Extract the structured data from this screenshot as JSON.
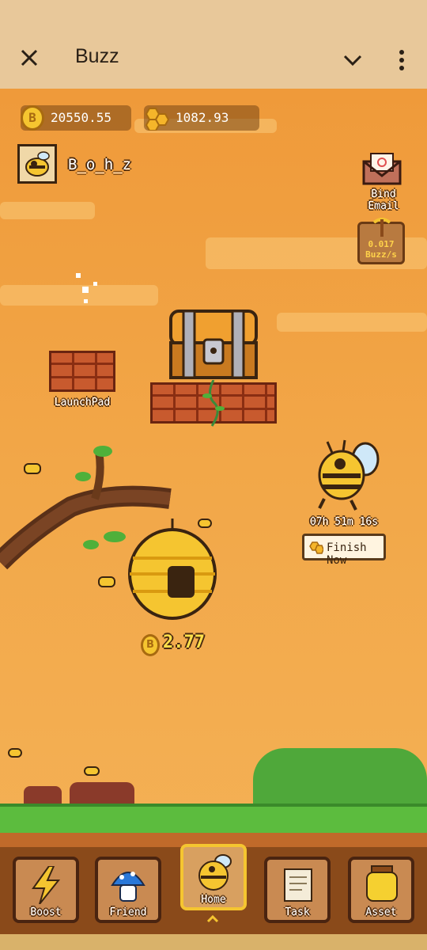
{
  "app_bar": {
    "title": "Buzz",
    "close_icon": "close-icon",
    "menu_icons": [
      "chevron-down-icon",
      "more-vert-icon"
    ]
  },
  "currencies": [
    {
      "icon": "coin-icon",
      "value": "20550.55"
    },
    {
      "icon": "honeycomb-icon",
      "value": "1082.93"
    }
  ],
  "user": {
    "name": "B_o_h_z",
    "avatar_icon": "bee-avatar-icon"
  },
  "side_actions": {
    "bind_email": "Bind Email",
    "mining_rate": "0.017",
    "mining_unit": "Buzz/s"
  },
  "launchpad": {
    "label": "LaunchPad"
  },
  "bee_timer": {
    "time": "07h 51m 16s",
    "button": "Finish Now"
  },
  "hive": {
    "coin_value": "2.77"
  },
  "nav": [
    {
      "label": "Boost",
      "icon": "lightning-icon"
    },
    {
      "label": "Friend",
      "icon": "mushroom-icon"
    },
    {
      "label": "Home",
      "icon": "bee-icon",
      "active": true
    },
    {
      "label": "Task",
      "icon": "scroll-icon"
    },
    {
      "label": "Asset",
      "icon": "honey-jar-icon"
    }
  ],
  "colors": {
    "sky": "#f0a947",
    "appbar": "#e8c89a",
    "grass": "#4fb03a",
    "nav_bg": "#8a4a1a"
  }
}
